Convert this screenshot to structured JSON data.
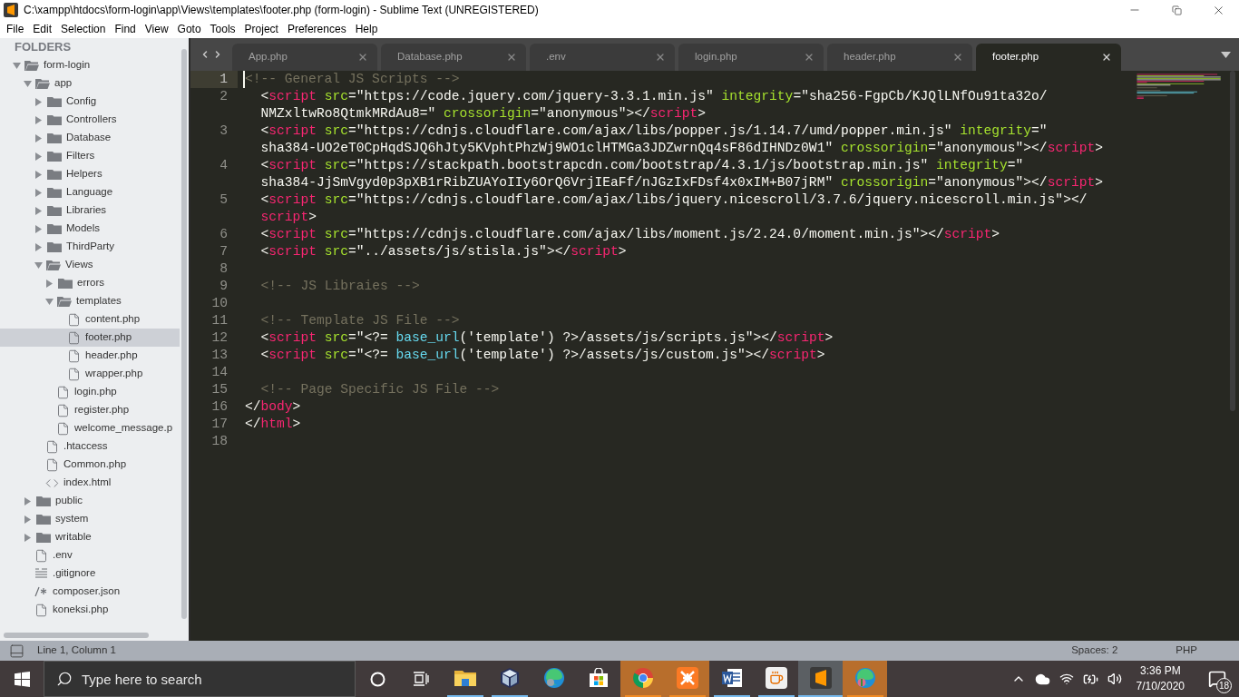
{
  "window": {
    "title": "C:\\xampp\\htdocs\\form-login\\app\\Views\\templates\\footer.php (form-login) - Sublime Text (UNREGISTERED)"
  },
  "menu": [
    "File",
    "Edit",
    "Selection",
    "Find",
    "View",
    "Goto",
    "Tools",
    "Project",
    "Preferences",
    "Help"
  ],
  "sidebar": {
    "heading": "FOLDERS",
    "tree": [
      {
        "name": "form-login",
        "kind": "folder",
        "expanded": true,
        "selected": false,
        "children": [
          {
            "name": "app",
            "kind": "folder",
            "expanded": true,
            "selected": false,
            "children": [
              {
                "name": "Config",
                "kind": "folder",
                "expanded": false,
                "selected": false
              },
              {
                "name": "Controllers",
                "kind": "folder",
                "expanded": false,
                "selected": false
              },
              {
                "name": "Database",
                "kind": "folder",
                "expanded": false,
                "selected": false
              },
              {
                "name": "Filters",
                "kind": "folder",
                "expanded": false,
                "selected": false
              },
              {
                "name": "Helpers",
                "kind": "folder",
                "expanded": false,
                "selected": false
              },
              {
                "name": "Language",
                "kind": "folder",
                "expanded": false,
                "selected": false
              },
              {
                "name": "Libraries",
                "kind": "folder",
                "expanded": false,
                "selected": false
              },
              {
                "name": "Models",
                "kind": "folder",
                "expanded": false,
                "selected": false
              },
              {
                "name": "ThirdParty",
                "kind": "folder",
                "expanded": false,
                "selected": false
              },
              {
                "name": "Views",
                "kind": "folder",
                "expanded": true,
                "selected": false,
                "children": [
                  {
                    "name": "errors",
                    "kind": "folder",
                    "expanded": false,
                    "selected": false
                  },
                  {
                    "name": "templates",
                    "kind": "folder",
                    "expanded": true,
                    "selected": false,
                    "children": [
                      {
                        "name": "content.php",
                        "kind": "file",
                        "selected": false
                      },
                      {
                        "name": "footer.php",
                        "kind": "file",
                        "selected": true
                      },
                      {
                        "name": "header.php",
                        "kind": "file",
                        "selected": false
                      },
                      {
                        "name": "wrapper.php",
                        "kind": "file",
                        "selected": false
                      }
                    ]
                  },
                  {
                    "name": "login.php",
                    "kind": "file",
                    "selected": false
                  },
                  {
                    "name": "register.php",
                    "kind": "file",
                    "selected": false
                  },
                  {
                    "name": "welcome_message.p",
                    "kind": "file",
                    "selected": false
                  }
                ]
              },
              {
                "name": ".htaccess",
                "kind": "file",
                "selected": false
              },
              {
                "name": "Common.php",
                "kind": "file",
                "selected": false
              },
              {
                "name": "index.html",
                "kind": "markup",
                "selected": false
              }
            ]
          },
          {
            "name": "public",
            "kind": "folder",
            "expanded": false,
            "selected": false
          },
          {
            "name": "system",
            "kind": "folder",
            "expanded": false,
            "selected": false
          },
          {
            "name": "writable",
            "kind": "folder",
            "expanded": false,
            "selected": false
          },
          {
            "name": ".env",
            "kind": "file",
            "selected": false
          },
          {
            "name": ".gitignore",
            "kind": "lines",
            "selected": false
          },
          {
            "name": "composer.json",
            "kind": "comment",
            "selected": false
          },
          {
            "name": "koneksi.php",
            "kind": "file",
            "selected": false
          }
        ]
      }
    ]
  },
  "tabs": [
    {
      "label": "App.php",
      "selected": false
    },
    {
      "label": "Database.php",
      "selected": false
    },
    {
      "label": ".env",
      "selected": false
    },
    {
      "label": "login.php",
      "selected": false
    },
    {
      "label": "header.php",
      "selected": false
    },
    {
      "label": "footer.php",
      "selected": true
    }
  ],
  "editor": {
    "lines": [
      {
        "number": "1",
        "current": true,
        "rows": [
          {
            "indented": false,
            "segments": [
              {
                "kind": "comment",
                "text": "<!-- General JS Scripts -->"
              }
            ]
          }
        ]
      },
      {
        "number": "2",
        "current": false,
        "rows": [
          {
            "indented": true,
            "segments": [
              {
                "kind": "plain",
                "text": "<"
              },
              {
                "kind": "tag",
                "text": "script"
              },
              {
                "kind": "attribute",
                "text": " src"
              },
              {
                "kind": "plain",
                "text": "=\"https://code.jquery.com/jquery-3.3.1.min.js\""
              },
              {
                "kind": "attribute",
                "text": " integrity"
              },
              {
                "kind": "plain",
                "text": "=\"sha256-FgpCb/KJQlLNfOu91ta32o/"
              }
            ]
          },
          {
            "indented": true,
            "segments": [
              {
                "kind": "plain",
                "text": "NMZxltwRo8QtmkMRdAu8=\""
              },
              {
                "kind": "attribute",
                "text": " crossorigin"
              },
              {
                "kind": "plain",
                "text": "=\"anonymous\"></"
              },
              {
                "kind": "tag",
                "text": "script"
              },
              {
                "kind": "plain",
                "text": ">"
              }
            ]
          }
        ]
      },
      {
        "number": "3",
        "current": false,
        "rows": [
          {
            "indented": true,
            "segments": [
              {
                "kind": "plain",
                "text": "<"
              },
              {
                "kind": "tag",
                "text": "script"
              },
              {
                "kind": "attribute",
                "text": " src"
              },
              {
                "kind": "plain",
                "text": "=\"https://cdnjs.cloudflare.com/ajax/libs/popper.js/1.14.7/umd/popper.min.js\""
              },
              {
                "kind": "attribute",
                "text": " integrity"
              },
              {
                "kind": "plain",
                "text": "=\""
              }
            ]
          },
          {
            "indented": true,
            "segments": [
              {
                "kind": "plain",
                "text": "sha384-UO2eT0CpHqdSJQ6hJty5KVphtPhzWj9WO1clHTMGa3JDZwrnQq4sF86dIHNDz0W1\""
              },
              {
                "kind": "attribute",
                "text": " crossorigin"
              },
              {
                "kind": "plain",
                "text": "=\"anonymous\"></"
              },
              {
                "kind": "tag",
                "text": "script"
              },
              {
                "kind": "plain",
                "text": ">"
              }
            ]
          }
        ]
      },
      {
        "number": "4",
        "current": false,
        "rows": [
          {
            "indented": true,
            "segments": [
              {
                "kind": "plain",
                "text": "<"
              },
              {
                "kind": "tag",
                "text": "script"
              },
              {
                "kind": "attribute",
                "text": " src"
              },
              {
                "kind": "plain",
                "text": "=\"https://stackpath.bootstrapcdn.com/bootstrap/4.3.1/js/bootstrap.min.js\""
              },
              {
                "kind": "attribute",
                "text": " integrity"
              },
              {
                "kind": "plain",
                "text": "=\""
              }
            ]
          },
          {
            "indented": true,
            "segments": [
              {
                "kind": "plain",
                "text": "sha384-JjSmVgyd0p3pXB1rRibZUAYoIIy6OrQ6VrjIEaFf/nJGzIxFDsf4x0xIM+B07jRM\""
              },
              {
                "kind": "attribute",
                "text": " crossorigin"
              },
              {
                "kind": "plain",
                "text": "=\"anonymous\"></"
              },
              {
                "kind": "tag",
                "text": "script"
              },
              {
                "kind": "plain",
                "text": ">"
              }
            ]
          }
        ]
      },
      {
        "number": "5",
        "current": false,
        "rows": [
          {
            "indented": true,
            "segments": [
              {
                "kind": "plain",
                "text": "<"
              },
              {
                "kind": "tag",
                "text": "script"
              },
              {
                "kind": "attribute",
                "text": " src"
              },
              {
                "kind": "plain",
                "text": "=\"https://cdnjs.cloudflare.com/ajax/libs/jquery.nicescroll/3.7.6/jquery.nicescroll.min.js\"></"
              }
            ]
          },
          {
            "indented": true,
            "segments": [
              {
                "kind": "tag",
                "text": "script"
              },
              {
                "kind": "plain",
                "text": ">"
              }
            ]
          }
        ]
      },
      {
        "number": "6",
        "current": false,
        "rows": [
          {
            "indented": true,
            "segments": [
              {
                "kind": "plain",
                "text": "<"
              },
              {
                "kind": "tag",
                "text": "script"
              },
              {
                "kind": "attribute",
                "text": " src"
              },
              {
                "kind": "plain",
                "text": "=\"https://cdnjs.cloudflare.com/ajax/libs/moment.js/2.24.0/moment.min.js\"></"
              },
              {
                "kind": "tag",
                "text": "script"
              },
              {
                "kind": "plain",
                "text": ">"
              }
            ]
          }
        ]
      },
      {
        "number": "7",
        "current": false,
        "rows": [
          {
            "indented": true,
            "segments": [
              {
                "kind": "plain",
                "text": "<"
              },
              {
                "kind": "tag",
                "text": "script"
              },
              {
                "kind": "attribute",
                "text": " src"
              },
              {
                "kind": "plain",
                "text": "=\"../assets/js/stisla.js\"></"
              },
              {
                "kind": "tag",
                "text": "script"
              },
              {
                "kind": "plain",
                "text": ">"
              }
            ]
          }
        ]
      },
      {
        "number": "8",
        "current": false
      },
      {
        "number": "9",
        "current": false,
        "rows": [
          {
            "indented": true,
            "segments": [
              {
                "kind": "comment",
                "text": "<!-- JS Libraies -->"
              }
            ]
          }
        ]
      },
      {
        "number": "10",
        "current": false
      },
      {
        "number": "11",
        "current": false,
        "rows": [
          {
            "indented": true,
            "segments": [
              {
                "kind": "comment",
                "text": "<!-- Template JS File -->"
              }
            ]
          }
        ]
      },
      {
        "number": "12",
        "current": false,
        "rows": [
          {
            "indented": true,
            "segments": [
              {
                "kind": "plain",
                "text": "<"
              },
              {
                "kind": "tag",
                "text": "script"
              },
              {
                "kind": "attribute",
                "text": " src"
              },
              {
                "kind": "plain",
                "text": "=\"<?= "
              },
              {
                "kind": "function",
                "text": "base_url"
              },
              {
                "kind": "plain",
                "text": "('template') ?>/assets/js/scripts.js\"></"
              },
              {
                "kind": "tag",
                "text": "script"
              },
              {
                "kind": "plain",
                "text": ">"
              }
            ]
          }
        ]
      },
      {
        "number": "13",
        "current": false,
        "rows": [
          {
            "indented": true,
            "segments": [
              {
                "kind": "plain",
                "text": "<"
              },
              {
                "kind": "tag",
                "text": "script"
              },
              {
                "kind": "attribute",
                "text": " src"
              },
              {
                "kind": "plain",
                "text": "=\"<?= "
              },
              {
                "kind": "function",
                "text": "base_url"
              },
              {
                "kind": "plain",
                "text": "('template') ?>/assets/js/custom.js\"></"
              },
              {
                "kind": "tag",
                "text": "script"
              },
              {
                "kind": "plain",
                "text": ">"
              }
            ]
          }
        ]
      },
      {
        "number": "14",
        "current": false
      },
      {
        "number": "15",
        "current": false,
        "rows": [
          {
            "indented": true,
            "segments": [
              {
                "kind": "comment",
                "text": "<!-- Page Specific JS File -->"
              }
            ]
          }
        ]
      },
      {
        "number": "16",
        "current": false,
        "rows": [
          {
            "indented": false,
            "segments": [
              {
                "kind": "plain",
                "text": "</"
              },
              {
                "kind": "tag",
                "text": "body"
              },
              {
                "kind": "plain",
                "text": ">"
              }
            ]
          }
        ]
      },
      {
        "number": "17",
        "current": false,
        "rows": [
          {
            "indented": false,
            "segments": [
              {
                "kind": "plain",
                "text": "</"
              },
              {
                "kind": "tag",
                "text": "html"
              },
              {
                "kind": "plain",
                "text": ">"
              }
            ]
          }
        ]
      },
      {
        "number": "18",
        "current": false
      }
    ]
  },
  "status_bar": {
    "position": "Line 1, Column 1",
    "indentation": "Spaces: 2",
    "syntax": "PHP"
  },
  "taskbar": {
    "search": {
      "placeholder": "Type here to search"
    },
    "apps": [
      {
        "kind": "explorer",
        "running": true,
        "active": false,
        "attention": false
      },
      {
        "kind": "cube",
        "running": true,
        "active": false,
        "attention": false
      },
      {
        "kind": "edge",
        "running": false,
        "active": false,
        "attention": false
      },
      {
        "kind": "store",
        "running": false,
        "active": false,
        "attention": false
      },
      {
        "kind": "chrome",
        "running": true,
        "active": false,
        "attention": true
      },
      {
        "kind": "xampp",
        "running": true,
        "active": false,
        "attention": true
      },
      {
        "kind": "word",
        "running": true,
        "active": false,
        "attention": false
      },
      {
        "kind": "java",
        "running": true,
        "active": false,
        "attention": false
      },
      {
        "kind": "sublime",
        "running": true,
        "active": true,
        "attention": false
      },
      {
        "kind": "edge-dev",
        "running": true,
        "active": false,
        "attention": true
      }
    ],
    "time": "3:36 PM",
    "date": "7/10/2020",
    "notifications": "18"
  }
}
